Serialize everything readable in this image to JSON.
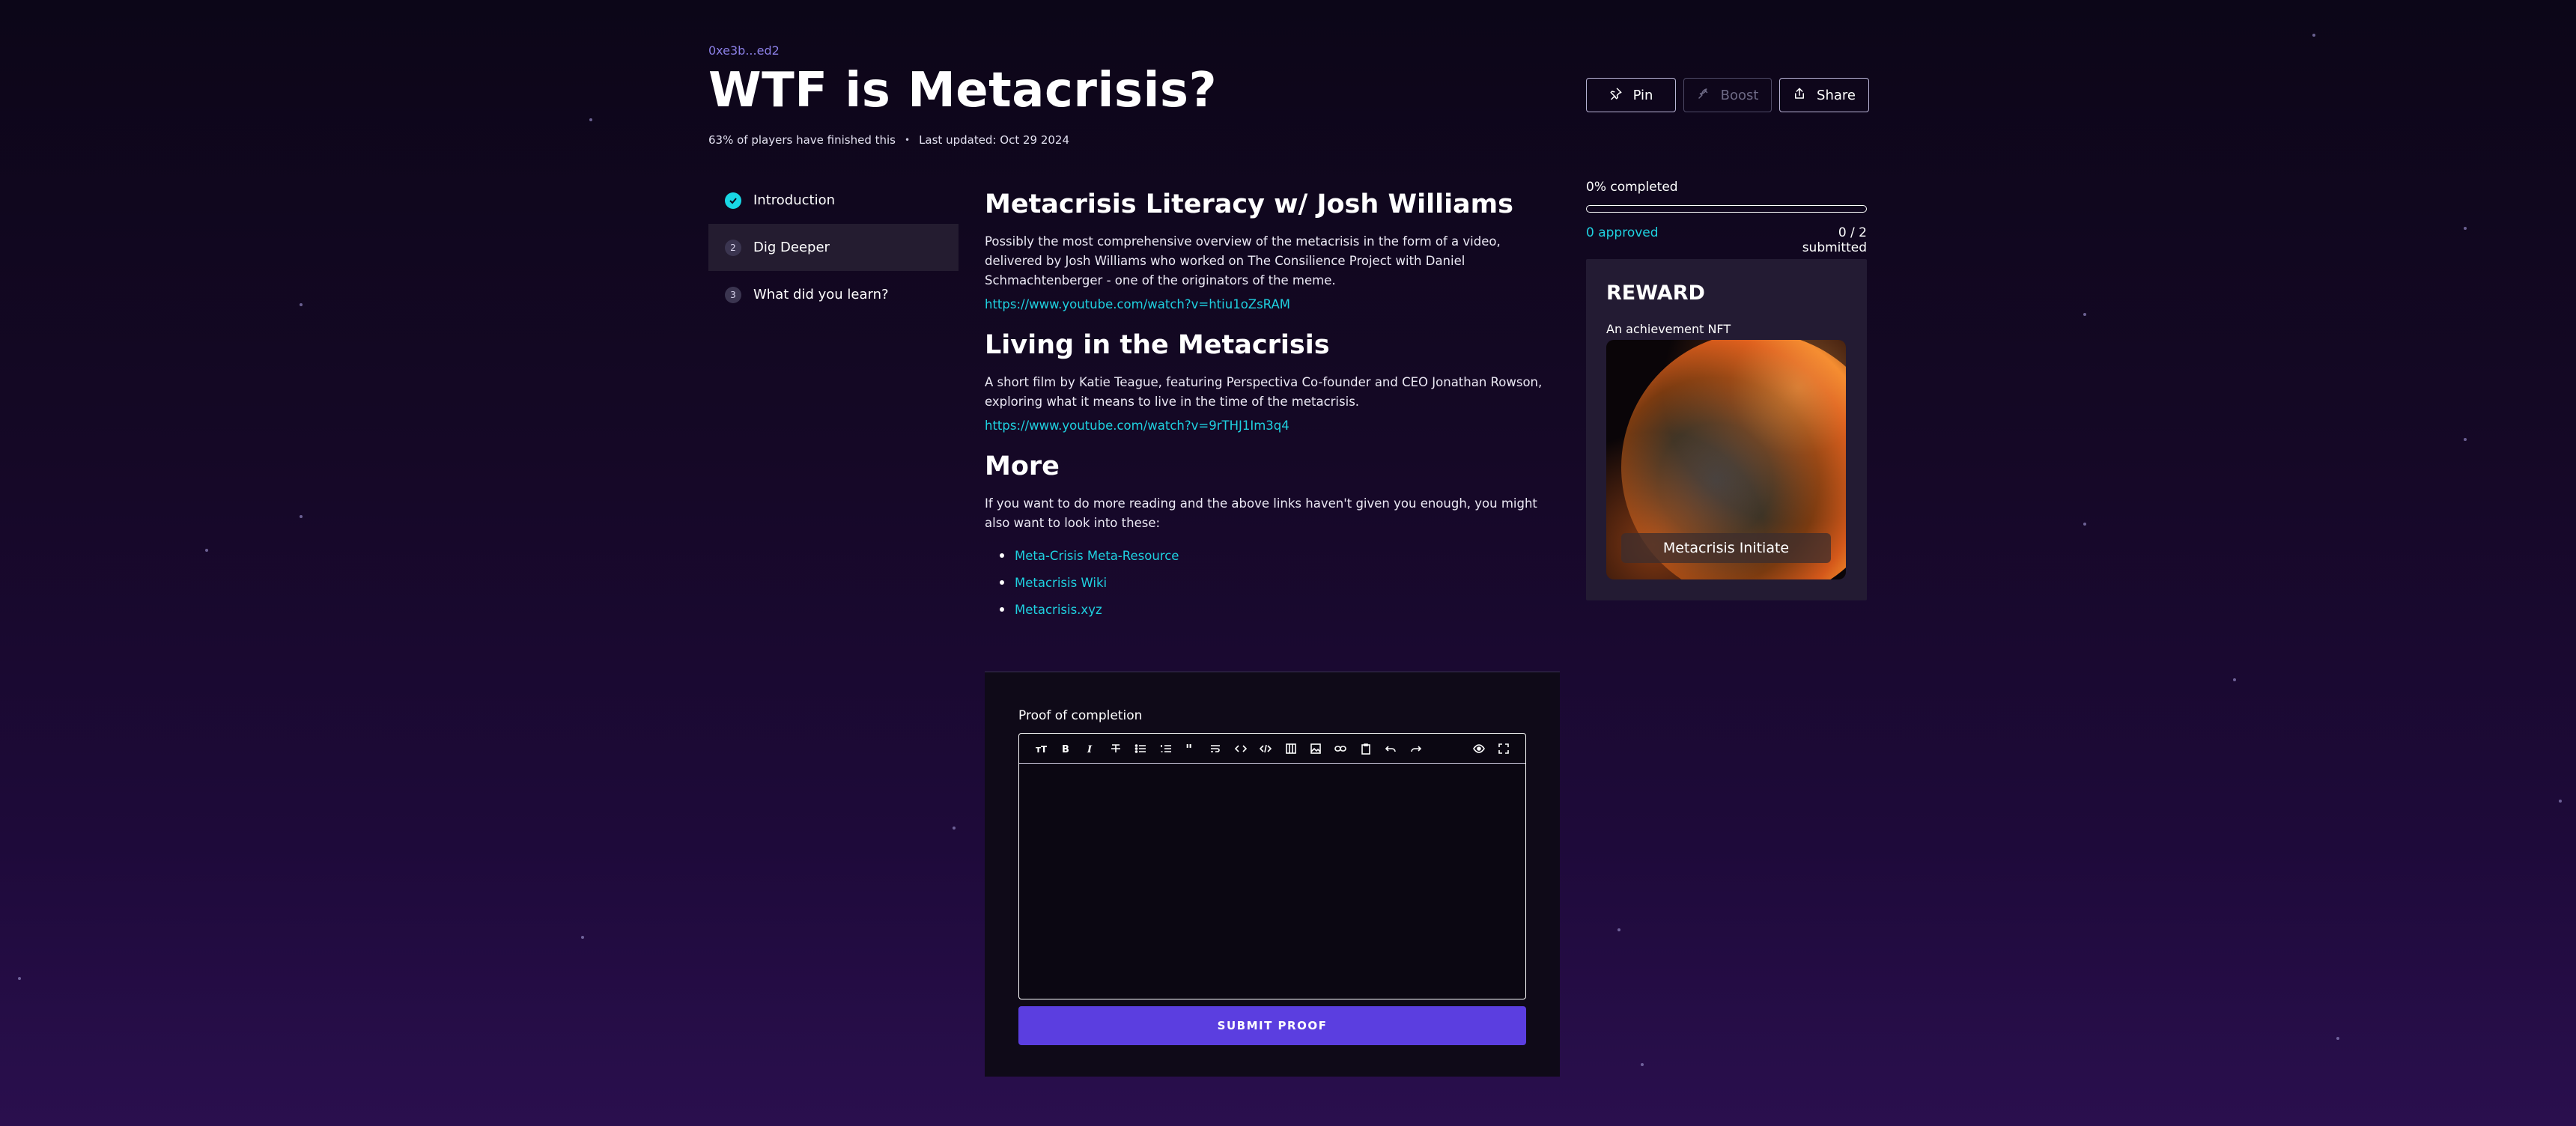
{
  "quest": {
    "author": "0xe3b...ed2",
    "title": "WTF is Metacrisis?",
    "finished_stat": "63% of players have finished this",
    "separator": "•",
    "last_updated": "Last updated: Oct 29 2024"
  },
  "actions": {
    "pin": "Pin",
    "boost": "Boost",
    "share": "Share"
  },
  "steps": [
    {
      "marker": "check",
      "label": "Introduction",
      "state": "completed"
    },
    {
      "marker": "2",
      "label": "Dig Deeper",
      "state": "active"
    },
    {
      "marker": "3",
      "label": "What did you learn?",
      "state": "default"
    }
  ],
  "content": {
    "section1": {
      "heading": "Metacrisis Literacy w/ Josh Williams",
      "body": "Possibly the most comprehensive overview of the metacrisis in the form of a video, delivered by Josh Williams who worked on The Consilience Project with Daniel Schmachtenberger - one of the originators of the meme.",
      "link": "https://www.youtube.com/watch?v=htiu1oZsRAM"
    },
    "section2": {
      "heading": "Living in the Metacrisis",
      "body": "A short film by Katie Teague, featuring Perspectiva Co-founder and CEO Jonathan Rowson, exploring what it means to live in the time of the metacrisis.",
      "link": "https://www.youtube.com/watch?v=9rTHJ1Im3q4"
    },
    "section3": {
      "heading": "More",
      "body": "If you want to do more reading and the above links haven't given you enough, you might also want to look into these:",
      "links": [
        "Meta-Crisis Meta-Resource",
        "Metacrisis Wiki",
        "Metacrisis.xyz"
      ]
    }
  },
  "proof": {
    "label": "Proof of completion",
    "editor_value": "",
    "toolbar_icons": [
      "heading-icon",
      "bold-icon",
      "italic-icon",
      "strikethrough-icon",
      "bullet-list-icon",
      "numbered-list-icon",
      "quote-icon",
      "clean-block-icon",
      "code-icon",
      "code-block-icon",
      "table-icon",
      "image-icon",
      "link-icon",
      "clipboard-icon",
      "undo-icon",
      "redo-icon",
      "preview-icon",
      "fullscreen-icon"
    ],
    "submit_label": "SUBMIT PROOF"
  },
  "progress": {
    "completed_label": "0% completed",
    "completed_fraction": 0,
    "approved": "0 approved",
    "submitted": "0 / 2 submitted"
  },
  "reward": {
    "title": "REWARD",
    "subtitle": "An achievement NFT",
    "nft_name": "Metacrisis Initiate"
  },
  "colors": {
    "accent_cyan": "#1fd1e0",
    "primary_button": "#5b3ee0",
    "author_link": "#8b7fe6"
  }
}
